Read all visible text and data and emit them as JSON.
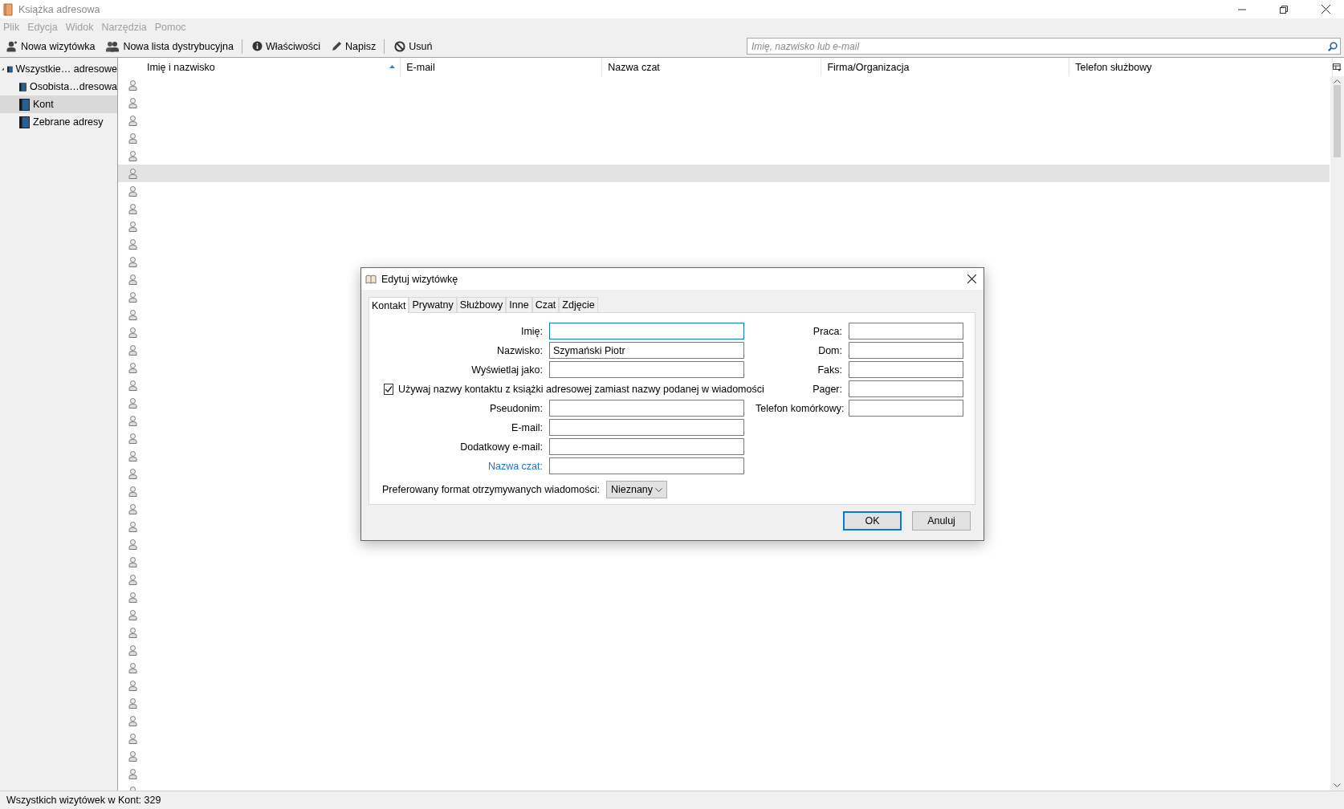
{
  "window": {
    "title": "Książka adresowa"
  },
  "menu": [
    {
      "label": "Plik"
    },
    {
      "label": "Edycja"
    },
    {
      "label": "Widok"
    },
    {
      "label": "Narzędzia"
    },
    {
      "label": "Pomoc"
    }
  ],
  "toolbar": [
    [
      {
        "label": "Nowa wizytówka"
      },
      {
        "label": "Nowa lista dystrybucyjna"
      }
    ],
    [
      {
        "label": "Właściwości"
      },
      {
        "label": "Napisz"
      }
    ],
    [
      {
        "label": "Usuń"
      }
    ]
  ],
  "search": {
    "placeholder": "Imię, nazwisko lub e-mail"
  },
  "sidebar": {
    "items": [
      {
        "label": "Wszystkie… adresowe",
        "expanded": true,
        "selected": false,
        "children": [
          {
            "label": "Osobista…dresowa",
            "selected": false
          },
          {
            "label": "Kont",
            "selected": true
          },
          {
            "label": "Zebrane adresy",
            "selected": false
          }
        ]
      }
    ]
  },
  "table": {
    "columns": [
      {
        "label": "Imię i nazwisko",
        "sorted": true
      },
      {
        "label": "E-mail",
        "sorted": false
      },
      {
        "label": "Nazwa czat",
        "sorted": false
      },
      {
        "label": "Firma/Organizacja",
        "sorted": false
      },
      {
        "label": "Telefon służbowy",
        "sorted": false
      }
    ],
    "rows": [
      {
        "selected": false
      },
      {
        "selected": false
      },
      {
        "selected": false
      },
      {
        "selected": false
      },
      {
        "selected": false
      },
      {
        "selected": true
      },
      {
        "selected": false
      },
      {
        "selected": false
      },
      {
        "selected": false
      },
      {
        "selected": false
      },
      {
        "selected": false
      },
      {
        "selected": false
      },
      {
        "selected": false
      },
      {
        "selected": false
      },
      {
        "selected": false
      },
      {
        "selected": false
      },
      {
        "selected": false
      },
      {
        "selected": false
      },
      {
        "selected": false
      },
      {
        "selected": false
      },
      {
        "selected": false
      },
      {
        "selected": false
      },
      {
        "selected": false
      },
      {
        "selected": false
      },
      {
        "selected": false
      },
      {
        "selected": false
      },
      {
        "selected": false
      },
      {
        "selected": false
      },
      {
        "selected": false
      },
      {
        "selected": false
      },
      {
        "selected": false
      },
      {
        "selected": false
      },
      {
        "selected": false
      },
      {
        "selected": false
      },
      {
        "selected": false
      },
      {
        "selected": false
      },
      {
        "selected": false
      },
      {
        "selected": false
      },
      {
        "selected": false
      },
      {
        "selected": false
      },
      {
        "selected": false
      }
    ]
  },
  "status_bar": "Wszystkich wizytówek w Kont: 329",
  "dialog": {
    "title": "Edytuj wizytówkę",
    "tabs": [
      {
        "label": "Kontakt",
        "selected": true
      },
      {
        "label": "Prywatny",
        "selected": false
      },
      {
        "label": "Służbowy",
        "selected": false
      },
      {
        "label": "Inne",
        "selected": false
      },
      {
        "label": "Czat",
        "selected": false
      },
      {
        "label": "Zdjęcie",
        "selected": false
      }
    ],
    "left": [
      {
        "kind": "field",
        "label": "Imię:",
        "focused": true
      },
      {
        "kind": "field",
        "label": "Nazwisko:",
        "value": "Szymański Piotr",
        "focused": false
      },
      {
        "kind": "field",
        "label": "Wyświetlaj jako:",
        "focused": false
      },
      {
        "kind": "checkbox",
        "label": "Używaj nazwy kontaktu z książki adresowej zamiast nazwy podanej w wiadomości",
        "checked": true
      },
      {
        "kind": "field",
        "label": "Pseudonim:",
        "focused": false
      },
      {
        "kind": "field",
        "label": "E-mail:",
        "focused": false
      },
      {
        "kind": "field",
        "label": "Dodatkowy e-mail:",
        "focused": false
      },
      {
        "kind": "link-field",
        "label": "Nazwa czat:",
        "focused": false
      }
    ],
    "right": [
      {
        "kind": "field",
        "label": "Praca:",
        "focused": false
      },
      {
        "kind": "field",
        "label": "Dom:",
        "focused": false
      },
      {
        "kind": "field",
        "label": "Faks:",
        "focused": false
      },
      {
        "kind": "field",
        "label": "Pager:",
        "focused": false
      },
      {
        "kind": "field",
        "label": "Telefon komórkowy:",
        "focused": false
      }
    ],
    "format": {
      "label": "Preferowany format otrzymywanych wiadomości:",
      "value": "Nieznany"
    },
    "buttons": [
      {
        "label": "OK",
        "default": true
      },
      {
        "label": "Anuluj",
        "default": false
      }
    ]
  }
}
